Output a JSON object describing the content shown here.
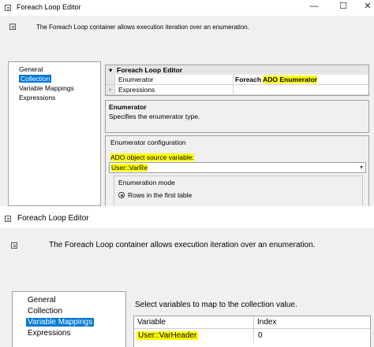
{
  "top": {
    "window_title": "Foreach Loop Editor",
    "controls": {
      "minimize": "—",
      "maximize": "☐",
      "close": "✕"
    },
    "description": "The Foreach Loop container allows execution iteration over an enumeration.",
    "nav": [
      "General",
      "Collection",
      "Variable Mappings",
      "Expressions"
    ],
    "nav_selected": 1,
    "grid": {
      "category": "Foreach Loop Editor",
      "rows": [
        {
          "label": "Enumerator",
          "value_prefix": "Foreach ",
          "value_highlight": "ADO Enumerator"
        },
        {
          "label": "Expressions",
          "value": ""
        }
      ]
    },
    "help_title": "Enumerator",
    "help_text": "Specifies the enumerator type.",
    "config_title": "Enumerator configuration",
    "source_label": "ADO object source variable:",
    "source_value": "User::VarRe",
    "mode_title": "Enumeration mode",
    "mode_option": "Rows in the first table"
  },
  "bottom": {
    "window_title": "Foreach Loop Editor",
    "description": "The Foreach Loop container allows execution iteration over an enumeration.",
    "nav": [
      "General",
      "Collection",
      "Variable Mappings",
      "Expressions"
    ],
    "nav_selected": 2,
    "map_label": "Select variables to map to the collection value.",
    "columns": [
      "Variable",
      "Index"
    ],
    "rows": [
      {
        "variable": "User::VarHeader",
        "index": "0"
      }
    ]
  },
  "colors": {
    "selection": "#0078d7",
    "highlight": "#ffff00",
    "panel": "#f0f0f0"
  }
}
